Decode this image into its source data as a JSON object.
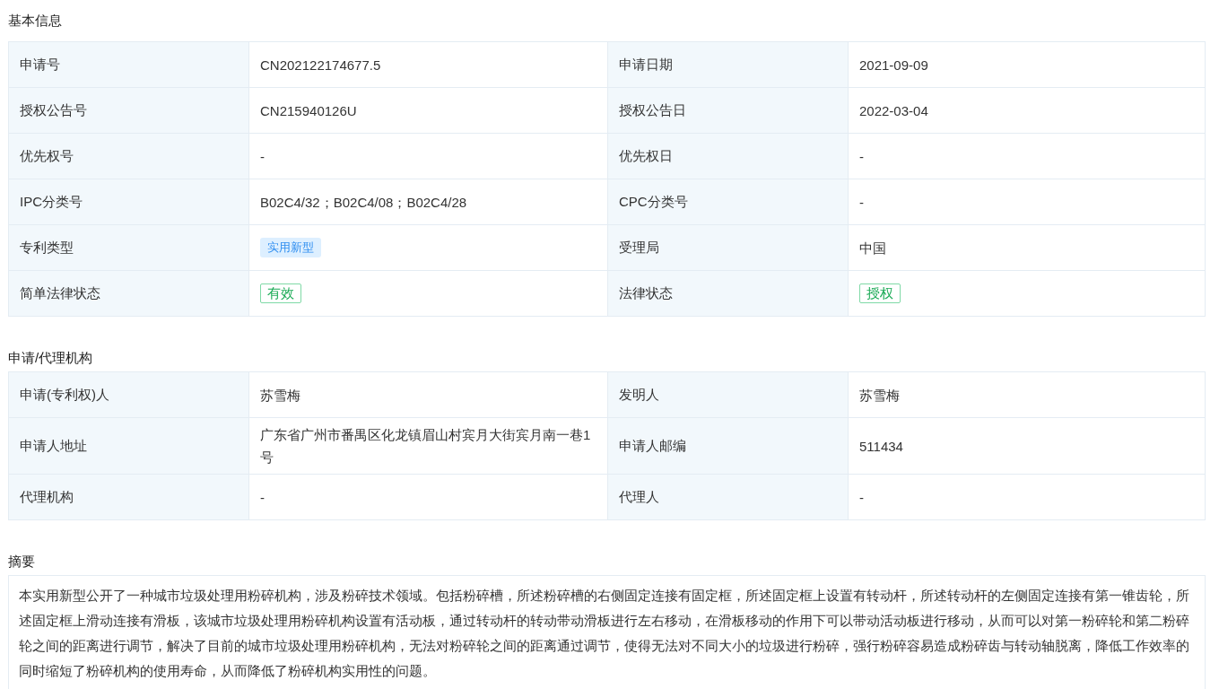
{
  "sections": [
    {
      "title": "基本信息",
      "kind": "table",
      "rows": [
        {
          "fields": [
            {
              "label": "申请号",
              "value": "CN202122174677.5",
              "kind": "text"
            },
            {
              "label": "申请日期",
              "value": "2021-09-09",
              "kind": "text"
            }
          ]
        },
        {
          "fields": [
            {
              "label": "授权公告号",
              "value": "CN215940126U",
              "kind": "text"
            },
            {
              "label": "授权公告日",
              "value": "2022-03-04",
              "kind": "text"
            }
          ]
        },
        {
          "fields": [
            {
              "label": "优先权号",
              "value": "-",
              "kind": "text"
            },
            {
              "label": "优先权日",
              "value": "-",
              "kind": "text"
            }
          ]
        },
        {
          "fields": [
            {
              "label": "IPC分类号",
              "value": "B02C4/32；B02C4/08；B02C4/28",
              "kind": "text"
            },
            {
              "label": "CPC分类号",
              "value": "-",
              "kind": "text"
            }
          ]
        },
        {
          "fields": [
            {
              "label": "专利类型",
              "value": "实用新型",
              "kind": "type_tag"
            },
            {
              "label": "受理局",
              "value": "中国",
              "kind": "text"
            }
          ]
        },
        {
          "fields": [
            {
              "label": "简单法律状态",
              "value": "有效",
              "kind": "status_tag"
            },
            {
              "label": "法律状态",
              "value": "授权",
              "kind": "status_tag"
            }
          ]
        }
      ]
    },
    {
      "title": "申请/代理机构",
      "kind": "table",
      "rows": [
        {
          "fields": [
            {
              "label": "申请(专利权)人",
              "value": "苏雪梅",
              "kind": "text"
            },
            {
              "label": "发明人",
              "value": "苏雪梅",
              "kind": "text"
            }
          ]
        },
        {
          "fields": [
            {
              "label": "申请人地址",
              "value": "广东省广州市番禺区化龙镇眉山村宾月大街宾月南一巷1号",
              "kind": "text"
            },
            {
              "label": "申请人邮编",
              "value": "511434",
              "kind": "text"
            }
          ]
        },
        {
          "fields": [
            {
              "label": "代理机构",
              "value": "-",
              "kind": "text"
            },
            {
              "label": "代理人",
              "value": "-",
              "kind": "text"
            }
          ]
        }
      ]
    },
    {
      "title": "摘要",
      "kind": "text",
      "text": "本实用新型公开了一种城市垃圾处理用粉碎机构，涉及粉碎技术领域。包括粉碎槽，所述粉碎槽的右侧固定连接有固定框，所述固定框上设置有转动杆，所述转动杆的左侧固定连接有第一锥齿轮，所述固定框上滑动连接有滑板，该城市垃圾处理用粉碎机构设置有活动板，通过转动杆的转动带动滑板进行左右移动，在滑板移动的作用下可以带动活动板进行移动，从而可以对第一粉碎轮和第二粉碎轮之间的距离进行调节，解决了目前的城市垃圾处理用粉碎机构，无法对粉碎轮之间的距离通过调节，使得无法对不同大小的垃圾进行粉碎，强行粉碎容易造成粉碎齿与转动轴脱离，降低工作效率的同时缩短了粉碎机构的使用寿命，从而降低了粉碎机构实用性的问题。"
    }
  ]
}
